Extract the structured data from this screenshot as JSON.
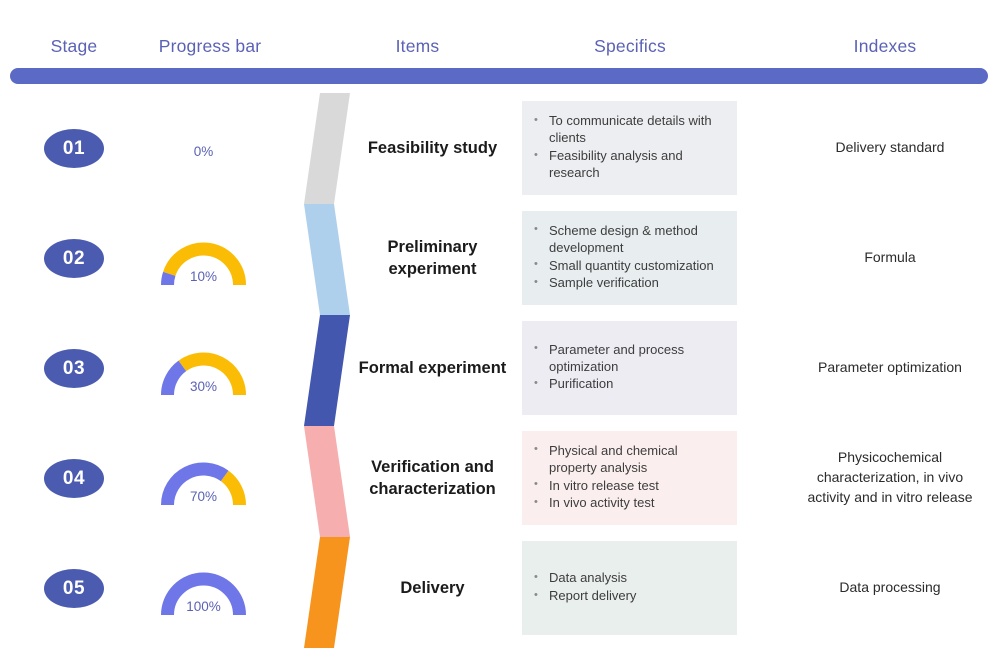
{
  "headers": {
    "stage": "Stage",
    "progress": "Progress bar",
    "items": "Items",
    "specifics": "Specifics",
    "indexes": "Indexes"
  },
  "colors": {
    "header_text": "#5b62b5",
    "divider_bar": "#5b6ac4",
    "badge": "#4a5bb0",
    "gauge_fill": "#6f76e8",
    "gauge_track": "#fbbc05"
  },
  "rows": [
    {
      "stage": "01",
      "progress_value": 0,
      "progress_label": "0%",
      "ribbon_color": "#d9d9d9",
      "item": "Feasibility study",
      "specs_bg": "#edeef1",
      "specs": [
        "To communicate details with clients",
        "Feasibility analysis and research"
      ],
      "index": "Delivery standard"
    },
    {
      "stage": "02",
      "progress_value": 10,
      "progress_label": "10%",
      "ribbon_color": "#aed0ec",
      "item": "Preliminary experiment",
      "specs_bg": "#e8eef0",
      "specs": [
        "Scheme design & method development",
        "Small quantity customization",
        "Sample verification"
      ],
      "index": "Formula"
    },
    {
      "stage": "03",
      "progress_value": 30,
      "progress_label": "30%",
      "ribbon_color": "#4257ad",
      "item": "Formal experiment",
      "specs_bg": "#eeecf3",
      "specs": [
        "Parameter and process optimization",
        "Purification"
      ],
      "index": "Parameter optimization"
    },
    {
      "stage": "04",
      "progress_value": 70,
      "progress_label": "70%",
      "ribbon_color": "#f6aeae",
      "item": "Verification and characterization",
      "specs_bg": "#fbeeee",
      "specs": [
        "Physical and chemical property analysis",
        "In vitro release test",
        "In vivo activity test"
      ],
      "index": "Physicochemical characterization, in vivo activity and in vitro release"
    },
    {
      "stage": "05",
      "progress_value": 100,
      "progress_label": "100%",
      "ribbon_color": "#f7941e",
      "item": "Delivery",
      "specs_bg": "#e9efec",
      "specs": [
        "Data analysis",
        "Report delivery"
      ],
      "index": "Data processing"
    }
  ]
}
